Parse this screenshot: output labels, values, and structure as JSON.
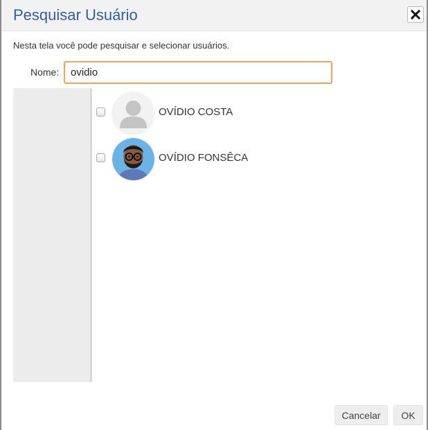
{
  "dialog": {
    "title": "Pesquisar Usuário",
    "description": "Nesta tela você pode pesquisar e selecionar usuários.",
    "close_icon": "close-icon"
  },
  "search": {
    "label": "Nome:",
    "value": "ovidio"
  },
  "results": [
    {
      "name": "OVÍDIO COSTA",
      "checked": false,
      "avatar": "default-user-avatar"
    },
    {
      "name": "OVÍDIO FONSÊCA",
      "checked": false,
      "avatar": "bearded-man-avatar"
    }
  ],
  "buttons": {
    "cancel_label": "Cancelar",
    "ok_label": "OK"
  },
  "colors": {
    "title": "#2f5f9e",
    "input_focus_border": "#f0a25a",
    "panel_bg": "#ececec",
    "button_bg": "#eeeeee"
  }
}
